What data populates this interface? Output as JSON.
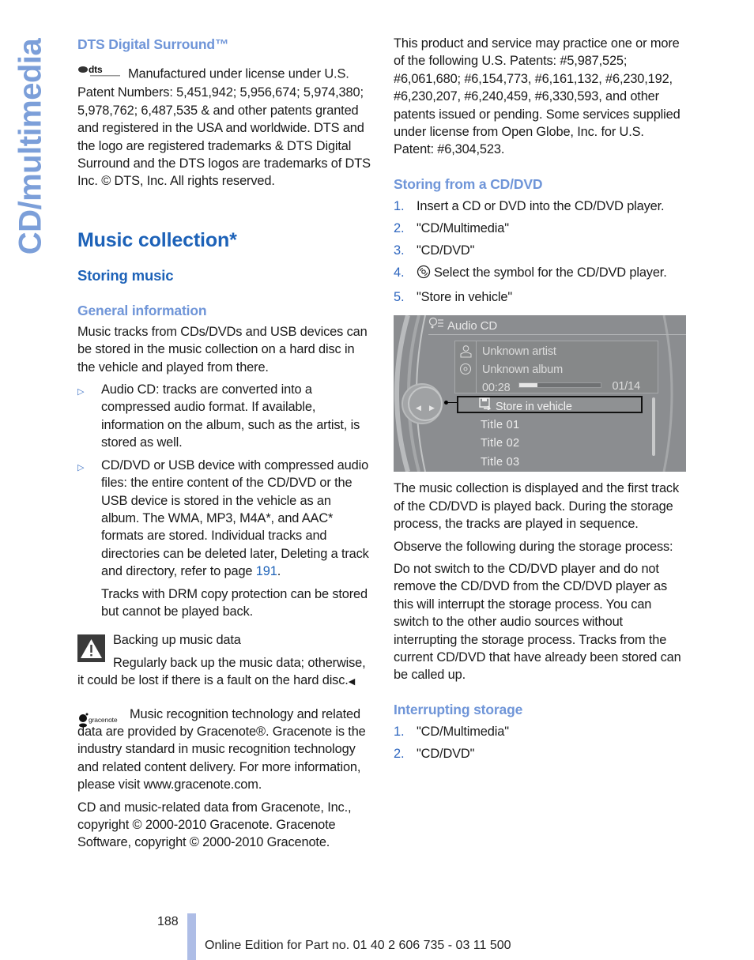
{
  "side_tab": "CD/multimedia",
  "left": {
    "dts": {
      "heading": "DTS Digital Surround™",
      "logo_icon": "dts-logo",
      "body": "Manufactured under license under U.S. Patent Numbers: 5,451,942; 5,956,674; 5,974,380; 5,978,762; 6,487,535 & and other patents granted and registered in the USA and worldwide. DTS and the logo are registered trademarks & DTS Digital Surround and the DTS logos are trademarks of DTS Inc. © DTS, Inc. All rights reserved."
    },
    "section_title": "Music collection*",
    "subsection_title": "Storing music",
    "general_heading": "General information",
    "general_intro": "Music tracks from CDs/DVDs and USB devices can be stored in the music collection on a hard disc in the vehicle and played from there.",
    "bullets": [
      {
        "marker": "▷",
        "text": "Audio CD: tracks are converted into a compressed audio format. If available, information on the album, such as the artist, is stored as well."
      },
      {
        "marker": "▷",
        "text_before_link": "CD/DVD or USB device with compressed audio files: the entire content of the CD/DVD or the USB device is stored in the vehicle as an album. The WMA, MP3, M4A*, and AAC* formats are stored. Individual tracks and directories can be deleted later, Deleting a track and directory, refer to page ",
        "link": "191",
        "text_after_link": "."
      }
    ],
    "drm_note": "Tracks with DRM copy protection can be stored but cannot be played back.",
    "warning": {
      "icon": "warning-triangle-icon",
      "title": "Backing up music data",
      "body": "Regularly back up the music data; otherwise, it could be lost if there is a fault on the hard disc.",
      "end_mark": "◀"
    },
    "gracenote": {
      "logo_icon": "gracenote-logo",
      "logo_text": "gracenote",
      "body": "Music recognition technology and related data are provided by Gracenote®. Gracenote is the industry standard in music recognition technology and related content delivery. For more information, please visit www.gracenote.com."
    },
    "copyright": "CD and music-related data from Gracenote, Inc., copyright © 2000-2010 Gracenote. Gracenote Software, copyright © 2000-2010 Gracenote."
  },
  "right": {
    "patents": "This product and service may practice one or more of the following U.S. Patents: #5,987,525; #6,061,680; #6,154,773, #6,161,132, #6,230,192, #6,230,207, #6,240,459, #6,330,593, and other patents issued or pending. Some services supplied under license from Open Globe, Inc. for U.S. Patent: #6,304,523.",
    "storing_heading": "Storing from a CD/DVD",
    "storing_steps": [
      {
        "num": "1.",
        "text": "Insert a CD or DVD into the CD/DVD player."
      },
      {
        "num": "2.",
        "text": "\"CD/Multimedia\""
      },
      {
        "num": "3.",
        "text": "\"CD/DVD\""
      },
      {
        "num": "4.",
        "icon": "cd-disc-icon",
        "text": "Select the symbol for the CD/DVD player."
      },
      {
        "num": "5.",
        "text": "\"Store in vehicle\""
      }
    ],
    "screen": {
      "title": "Audio CD",
      "artist": "Unknown artist",
      "album": "Unknown album",
      "elapsed": "00:28",
      "progress_fraction": 0.22,
      "track_count": "01/14",
      "selected_item": "Store in vehicle",
      "items": [
        "Title  01",
        "Title  02",
        "Title  03"
      ]
    },
    "after_screen": "The music collection is displayed and the first track of the CD/DVD is played back. During the storage process, the tracks are played in sequence.",
    "observe": "Observe the following during the storage process:",
    "do_not": "Do not switch to the CD/DVD player and do not remove the CD/DVD from the CD/DVD player as this will interrupt the storage process. You can switch to the other audio sources without interrupting the storage process. Tracks from the current CD/DVD that have already been stored can be called up.",
    "interrupt_heading": "Interrupting storage",
    "interrupt_steps": [
      {
        "num": "1.",
        "text": "\"CD/Multimedia\""
      },
      {
        "num": "2.",
        "text": "\"CD/DVD\""
      }
    ]
  },
  "footer": {
    "page_number": "188",
    "edition": "Online Edition for Part no. 01 40 2 606 735 - 03 11 500"
  }
}
